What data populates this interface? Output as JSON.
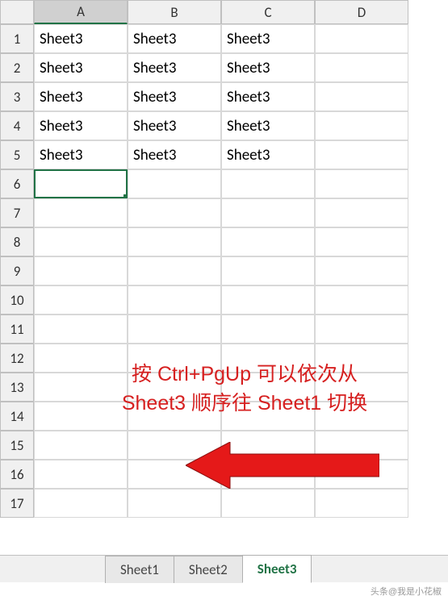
{
  "columns": [
    "A",
    "B",
    "C",
    "D"
  ],
  "rows": [
    "1",
    "2",
    "3",
    "4",
    "5",
    "6",
    "7",
    "8",
    "9",
    "10",
    "11",
    "12",
    "13",
    "14",
    "15",
    "16",
    "17"
  ],
  "active_column": "A",
  "selected_cell": {
    "row": 6,
    "col": "A"
  },
  "cells": {
    "r1": {
      "A": "Sheet3",
      "B": "Sheet3",
      "C": "Sheet3"
    },
    "r2": {
      "A": "Sheet3",
      "B": "Sheet3",
      "C": "Sheet3"
    },
    "r3": {
      "A": "Sheet3",
      "B": "Sheet3",
      "C": "Sheet3"
    },
    "r4": {
      "A": "Sheet3",
      "B": "Sheet3",
      "C": "Sheet3"
    },
    "r5": {
      "A": "Sheet3",
      "B": "Sheet3",
      "C": "Sheet3"
    }
  },
  "annotation": {
    "line1": "按 Ctrl+PgUp 可以依次从",
    "line2": "Sheet3 顺序往 Sheet1 切换"
  },
  "tabs": {
    "t1": "Sheet1",
    "t2": "Sheet2",
    "t3": "Sheet3"
  },
  "active_tab": "Sheet3",
  "watermark": "头条@我是小花椒"
}
